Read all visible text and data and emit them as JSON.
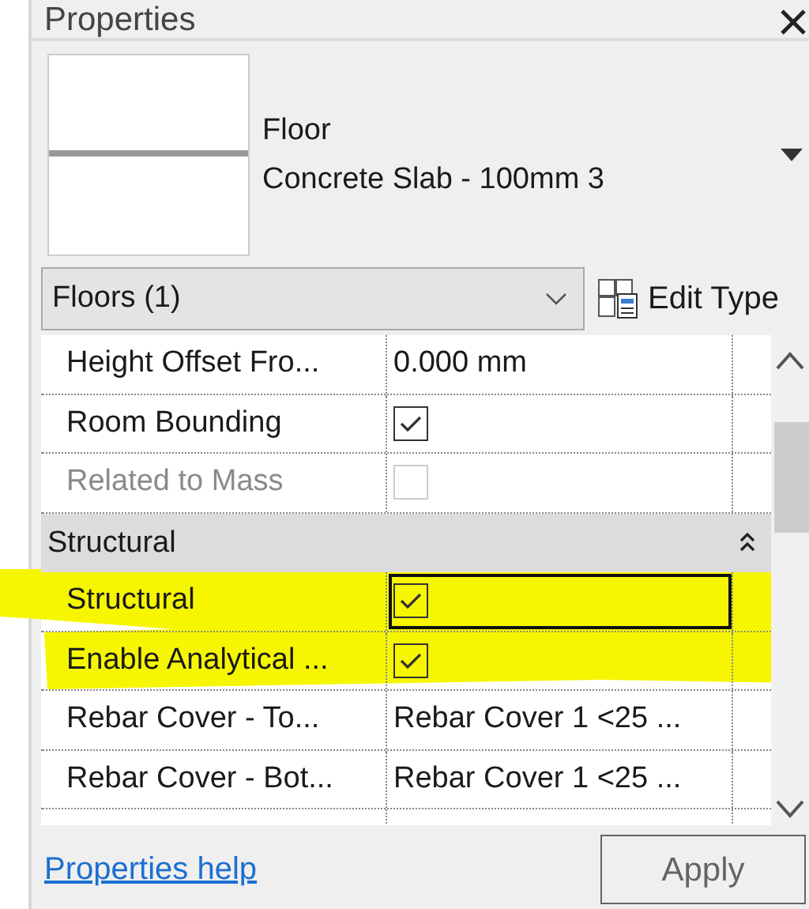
{
  "panel": {
    "title": "Properties"
  },
  "type_selector": {
    "family": "Floor",
    "type": "Concrete Slab - 100mm 3"
  },
  "filter": {
    "value": "Floors (1)"
  },
  "edit_type": {
    "label": "Edit Type"
  },
  "rows": [
    {
      "kind": "text",
      "label": "Height Offset Fro...",
      "value": "0.000 mm",
      "disabled": false,
      "selected": false
    },
    {
      "kind": "checkbox",
      "label": "Room Bounding",
      "checked": true,
      "disabled": false,
      "selected": false
    },
    {
      "kind": "checkbox",
      "label": "Related to Mass",
      "checked": false,
      "disabled": true,
      "selected": false
    },
    {
      "kind": "header",
      "label": "Structural",
      "expanded": true
    },
    {
      "kind": "checkbox",
      "label": "Structural",
      "checked": true,
      "disabled": false,
      "selected": true
    },
    {
      "kind": "checkbox",
      "label": "Enable Analytical ...",
      "checked": true,
      "disabled": false,
      "selected": false
    },
    {
      "kind": "text",
      "label": "Rebar Cover - To...",
      "value": "Rebar Cover 1 <25 ...",
      "disabled": false,
      "selected": false
    },
    {
      "kind": "text",
      "label": "Rebar Cover - Bot...",
      "value": "Rebar Cover 1 <25 ...",
      "disabled": false,
      "selected": false
    },
    {
      "kind": "cut"
    }
  ],
  "help_link": {
    "label": "Properties help"
  },
  "apply": {
    "label": "Apply",
    "disabled": true
  }
}
